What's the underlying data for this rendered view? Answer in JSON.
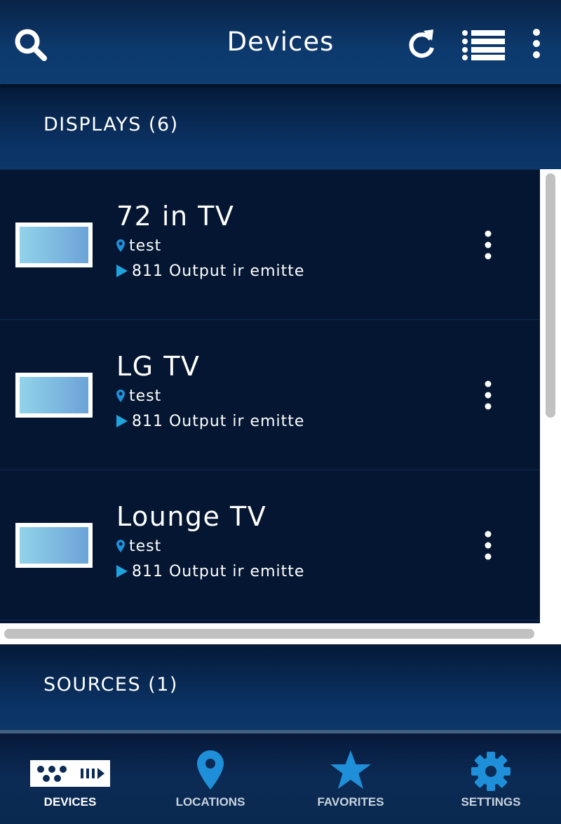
{
  "header": {
    "title": "Devices"
  },
  "sections": {
    "displays": {
      "label": "DISPLAYS (6)"
    },
    "sources": {
      "label": "SOURCES (1)"
    }
  },
  "devices": [
    {
      "name": "72 in TV",
      "location": "test",
      "output": "811 Output ir emitte"
    },
    {
      "name": "LG TV",
      "location": "test",
      "output": "811 Output ir emitte"
    },
    {
      "name": "Lounge TV",
      "location": "test",
      "output": "811 Output ir emitte"
    }
  ],
  "nav": {
    "devices": "DEVICES",
    "locations": "LOCATIONS",
    "favorites": "FAVORITES",
    "settings": "SETTINGS"
  },
  "colors": {
    "accent_blue": "#1e8fd8",
    "background": "#041631",
    "header_blue": "#0c3a6e"
  },
  "icons": {
    "search": "search-icon",
    "refresh": "refresh-icon",
    "list": "list-view-icon",
    "more": "more-vertical-icon",
    "location_pin": "location-pin-icon",
    "output": "play-output-icon",
    "devices_nav": "devices-remote-icon",
    "locations_nav": "location-pin-icon",
    "favorites_nav": "star-icon",
    "settings_nav": "gear-icon"
  }
}
